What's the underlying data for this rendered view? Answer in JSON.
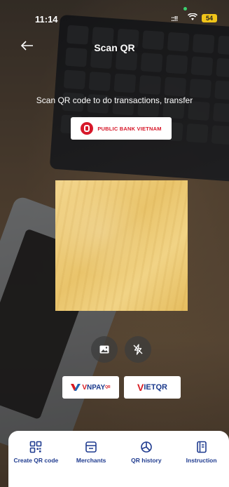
{
  "status_bar": {
    "time": "11:14",
    "signal": "::!!",
    "battery": "54"
  },
  "header": {
    "title": "Scan QR",
    "back_icon": "arrow-left-icon"
  },
  "subtitle": "Scan QR code to do transactions, transfer",
  "bank_logo": {
    "name": "PUBLIC BANK VIETNAM",
    "brand_color": "#d7182a"
  },
  "tools": [
    {
      "name": "gallery",
      "icon": "image-icon"
    },
    {
      "name": "flash",
      "icon": "flash-off-icon"
    }
  ],
  "partners": {
    "vnpay": {
      "prefix": "V",
      "main": "NPAY",
      "sup": "QR"
    },
    "vietqr": {
      "prefix": "V",
      "main": "IETQR"
    }
  },
  "bottom_nav": {
    "items": [
      {
        "label": "Create QR code",
        "icon": "qr-code-icon"
      },
      {
        "label": "Merchants",
        "icon": "storefront-icon"
      },
      {
        "label": "QR history",
        "icon": "history-pie-icon"
      },
      {
        "label": "Instruction",
        "icon": "document-icon"
      }
    ],
    "accent_color": "#1f3b8f"
  }
}
